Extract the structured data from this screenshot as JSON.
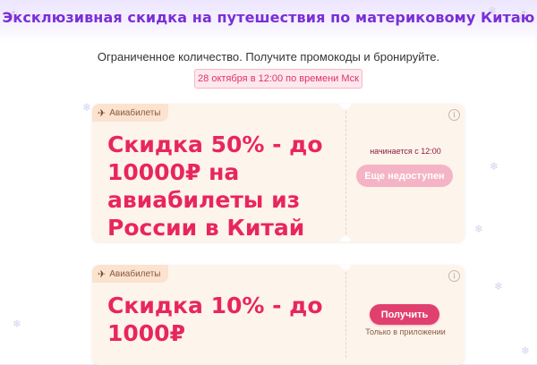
{
  "page": {
    "title": "Эксклюзивная скидка на путешествия по материковому Китаю",
    "subtitle": "Ограниченное количество. Получите промокоды и бронируйте.",
    "date_badge": "28 октября в 12:00 по времени Мск"
  },
  "colors": {
    "title": "#7a2fd6",
    "accent": "#e8265e",
    "card_bg": "#fdf4ec",
    "button_active": "#e0406e",
    "button_disabled": "#f4b4c5",
    "badge_bg": "#fde8ee"
  },
  "icons": {
    "tag": "airplane-icon",
    "info": "info-icon",
    "decor": [
      "snowman-icon",
      "snowflake-icon"
    ]
  },
  "cards": [
    {
      "tag": "Авиабилеты",
      "offer": "Скидка 50% - до 10000₽ на авиабилеты из России в Китай",
      "start_time": "начинается с 12:00",
      "button": "Еще недоступен",
      "button_state": "disabled"
    },
    {
      "tag": "Авиабилеты",
      "offer": "Скидка 10% - до 1000₽",
      "button": "Получить",
      "button_state": "active",
      "note": "Только в приложении"
    }
  ]
}
